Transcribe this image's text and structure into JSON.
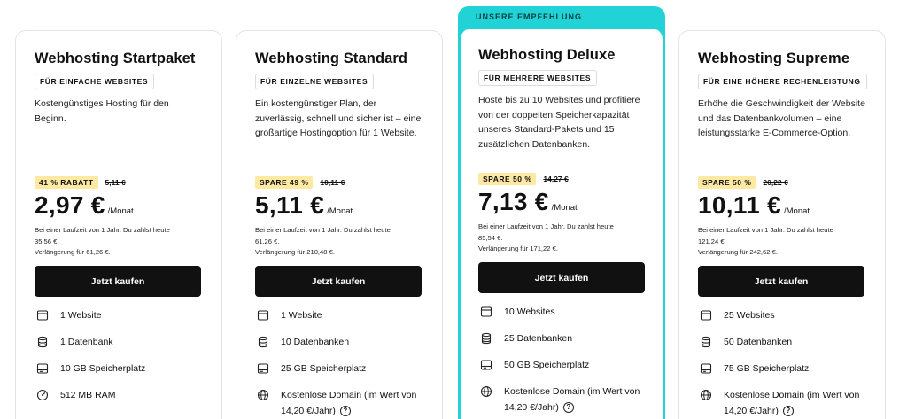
{
  "recommendation": "UNSERE EMPFEHLUNG",
  "plans": [
    {
      "title": "Webhosting Startpaket",
      "tag": "FÜR EINFACHE WEBSITES",
      "description": "Kostengünstiges Hosting für den Beginn.",
      "badge": "41 % RABATT",
      "old_price": "5,11 €",
      "price": "2,97 €",
      "per": "/Monat",
      "note_line1": "Bei einer Laufzeit von 1 Jahr. Du zahlst heute",
      "note_line2": "35,56 €.",
      "note_line3": "Verlängerung für 61,26 €.",
      "cta": "Jetzt kaufen",
      "features": [
        {
          "icon": "browser-window-icon",
          "text": "1 Website"
        },
        {
          "icon": "database-icon",
          "text": "1 Datenbank"
        },
        {
          "icon": "hard-drive-icon",
          "text": "10 GB Speicherplatz"
        },
        {
          "icon": "gauge-icon",
          "text": "512 MB RAM"
        }
      ]
    },
    {
      "title": "Webhosting Standard",
      "tag": "FÜR EINZELNE WEBSITES",
      "description": "Ein kostengünstiger Plan, der zuverlässig, schnell und sicher ist – eine großartige Hostingoption für 1 Website.",
      "badge": "SPARE 49 %",
      "old_price": "10,11 €",
      "price": "5,11 €",
      "per": "/Monat",
      "note_line1": "Bei einer Laufzeit von 1 Jahr. Du zahlst heute",
      "note_line2": "61,26 €.",
      "note_line3": "Verlängerung für 210,48 €.",
      "cta": "Jetzt kaufen",
      "features": [
        {
          "icon": "browser-window-icon",
          "text": "1 Website"
        },
        {
          "icon": "database-icon",
          "text": "10 Datenbanken"
        },
        {
          "icon": "hard-drive-icon",
          "text": "25 GB Speicherplatz"
        },
        {
          "icon": "globe-icon",
          "text": "Kostenlose Domain (im Wert von 14,20 €/Jahr)"
        }
      ]
    },
    {
      "title": "Webhosting Deluxe",
      "tag": "FÜR MEHRERE WEBSITES",
      "description": "Hoste bis zu 10 Websites und profitiere von der doppelten Speicherkapazität unseres Standard-Pakets und 15 zusätzlichen Datenbanken.",
      "badge": "SPARE 50 %",
      "old_price": "14,27 €",
      "price": "7,13 €",
      "per": "/Monat",
      "note_line1": "Bei einer Laufzeit von 1 Jahr. Du zahlst heute",
      "note_line2": "85,54 €.",
      "note_line3": "Verlängerung für 171,22 €.",
      "cta": "Jetzt kaufen",
      "features": [
        {
          "icon": "browser-window-icon",
          "text": "10 Websites"
        },
        {
          "icon": "database-icon",
          "text": "25 Datenbanken"
        },
        {
          "icon": "hard-drive-icon",
          "text": "50 GB Speicherplatz"
        },
        {
          "icon": "globe-icon",
          "text": "Kostenlose Domain (im Wert von 14,20 €/Jahr)"
        }
      ]
    },
    {
      "title": "Webhosting Supreme",
      "tag": "FÜR EINE HÖHERE RECHENLEISTUNG",
      "description": "Erhöhe die Geschwindigkeit der Website und das Datenbankvolumen – eine leistungsstarke E-Commerce-Option.",
      "badge": "SPARE 50 %",
      "old_price": "20,22 €",
      "price": "10,11 €",
      "per": "/Monat",
      "note_line1": "Bei einer Laufzeit von 1 Jahr. Du zahlst heute",
      "note_line2": "121,24 €.",
      "note_line3": "Verlängerung für 242,62 €.",
      "cta": "Jetzt kaufen",
      "features": [
        {
          "icon": "browser-window-icon",
          "text": "25 Websites"
        },
        {
          "icon": "database-icon",
          "text": "50 Datenbanken"
        },
        {
          "icon": "hard-drive-icon",
          "text": "75 GB Speicherplatz"
        },
        {
          "icon": "globe-icon",
          "text": "Kostenlose Domain (im Wert von 14,20 €/Jahr)"
        }
      ]
    }
  ],
  "help_symbol": "?",
  "colors": {
    "accent": "#21d3d6",
    "badge": "#fde9a2",
    "button": "#111111"
  }
}
